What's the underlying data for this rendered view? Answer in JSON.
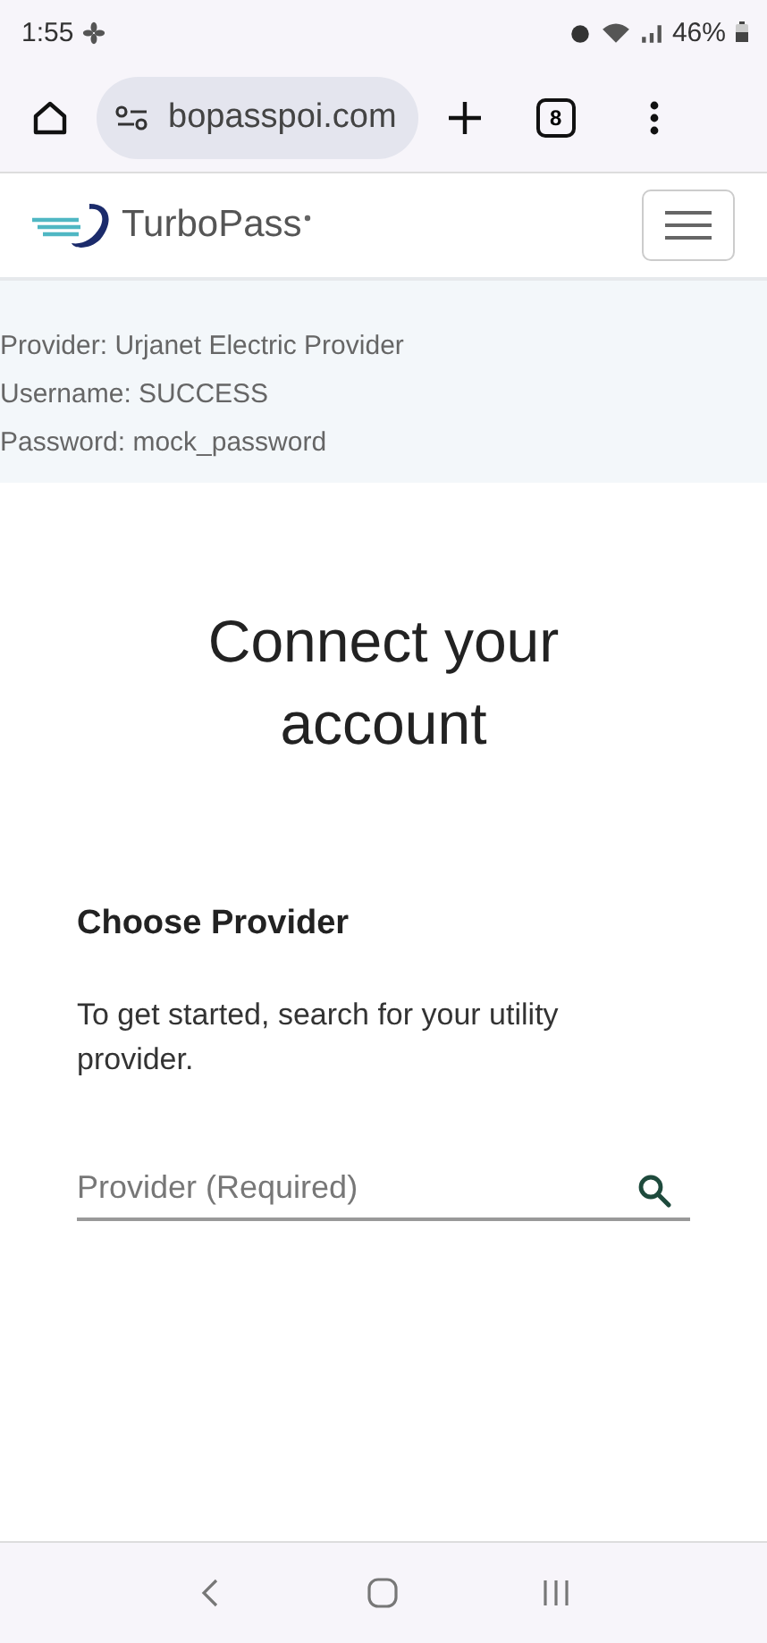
{
  "status_bar": {
    "time": "1:55",
    "battery": "46%"
  },
  "browser": {
    "url": "bopasspoi.com",
    "tab_count": "8"
  },
  "header": {
    "brand": "TurboPass"
  },
  "credentials": [
    "Provider: Urjanet Electric Provider",
    "Username: SUCCESS",
    "Password: mock_password"
  ],
  "main": {
    "title": "Connect your account",
    "section_title": "Choose Provider",
    "description": "To get started, search for your utility provider.",
    "search": {
      "placeholder": "Provider (Required)"
    }
  }
}
